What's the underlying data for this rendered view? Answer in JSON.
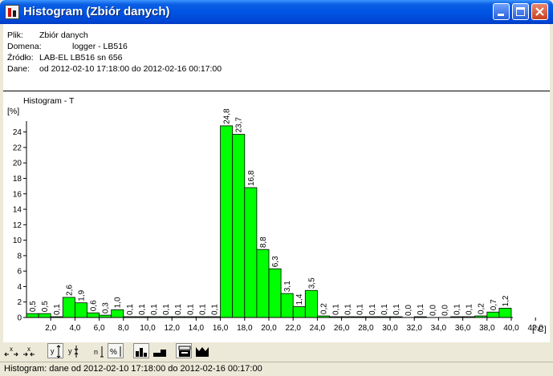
{
  "window": {
    "title": "Histogram (Zbiór danych)"
  },
  "info": {
    "rows": [
      {
        "label": "Plik:",
        "value": "Zbiór danych"
      },
      {
        "label": "Domena:",
        "value": "logger - LB516"
      },
      {
        "label": "Źródło:",
        "value": "LAB-EL LB516 sn 656"
      },
      {
        "label": "Dane:",
        "value": "od 2012-02-10 17:18:00 do 2012-02-16 00:17:00"
      }
    ]
  },
  "chart_data": {
    "type": "bar",
    "title": "Histogram - T",
    "ylabel": "[%]",
    "xlabel": "[°C]",
    "ylim": [
      0,
      25
    ],
    "y_ticks": [
      0,
      2,
      4,
      6,
      8,
      10,
      12,
      14,
      16,
      18,
      20,
      22,
      24
    ],
    "x_ticks": [
      "2,0",
      "4,0",
      "6,0",
      "8,0",
      "10,0",
      "12,0",
      "14,0",
      "16,0",
      "18,0",
      "20,0",
      "22,0",
      "24,0",
      "26,0",
      "28,0",
      "30,0",
      "32,0",
      "34,0",
      "36,0",
      "38,0",
      "40,0",
      "42,0"
    ],
    "bar_labels": [
      "0,5",
      "0,5",
      "0,1",
      "2,6",
      "1,9",
      "0,6",
      "0,3",
      "1,0",
      "0,1",
      "0,1",
      "0,1",
      "0,1",
      "0,1",
      "0,1",
      "0,1",
      "0,1",
      "24,8",
      "23,7",
      "16,8",
      "8,8",
      "6,3",
      "3,1",
      "1,4",
      "3,5",
      "0,2",
      "0,1",
      "0,1",
      "0,1",
      "0,1",
      "0,1",
      "0,1",
      "0,0",
      "0,1",
      "0,0",
      "0,0",
      "0,1",
      "0,1",
      "0,2",
      "0,7",
      "1,2"
    ],
    "values": [
      0.5,
      0.5,
      0.1,
      2.6,
      1.9,
      0.6,
      0.3,
      1.0,
      0.1,
      0.1,
      0.1,
      0.1,
      0.1,
      0.1,
      0.1,
      0.1,
      24.8,
      23.7,
      16.8,
      8.8,
      6.3,
      3.1,
      1.4,
      3.5,
      0.2,
      0.1,
      0.1,
      0.1,
      0.1,
      0.1,
      0.1,
      0.0,
      0.1,
      0.0,
      0.0,
      0.1,
      0.1,
      0.2,
      0.7,
      1.2
    ],
    "bar_color": "#00ff00"
  },
  "toolbar": {
    "buttons": [
      {
        "icon": "zoom-x-icon"
      },
      {
        "icon": "unzoom-x-icon"
      },
      {
        "icon": "zoom-y-icon"
      },
      {
        "icon": "unzoom-y-icon"
      },
      {
        "icon": "count-mode-icon"
      },
      {
        "icon": "percent-mode-icon"
      },
      {
        "icon": "bar-labels-icon"
      },
      {
        "icon": "bar-style-icon"
      },
      {
        "icon": "print-icon"
      },
      {
        "icon": "chart-icon"
      }
    ]
  },
  "status": {
    "text": "Histogram: dane od 2012-02-10 17:18:00 do 2012-02-16 00:17:00"
  }
}
